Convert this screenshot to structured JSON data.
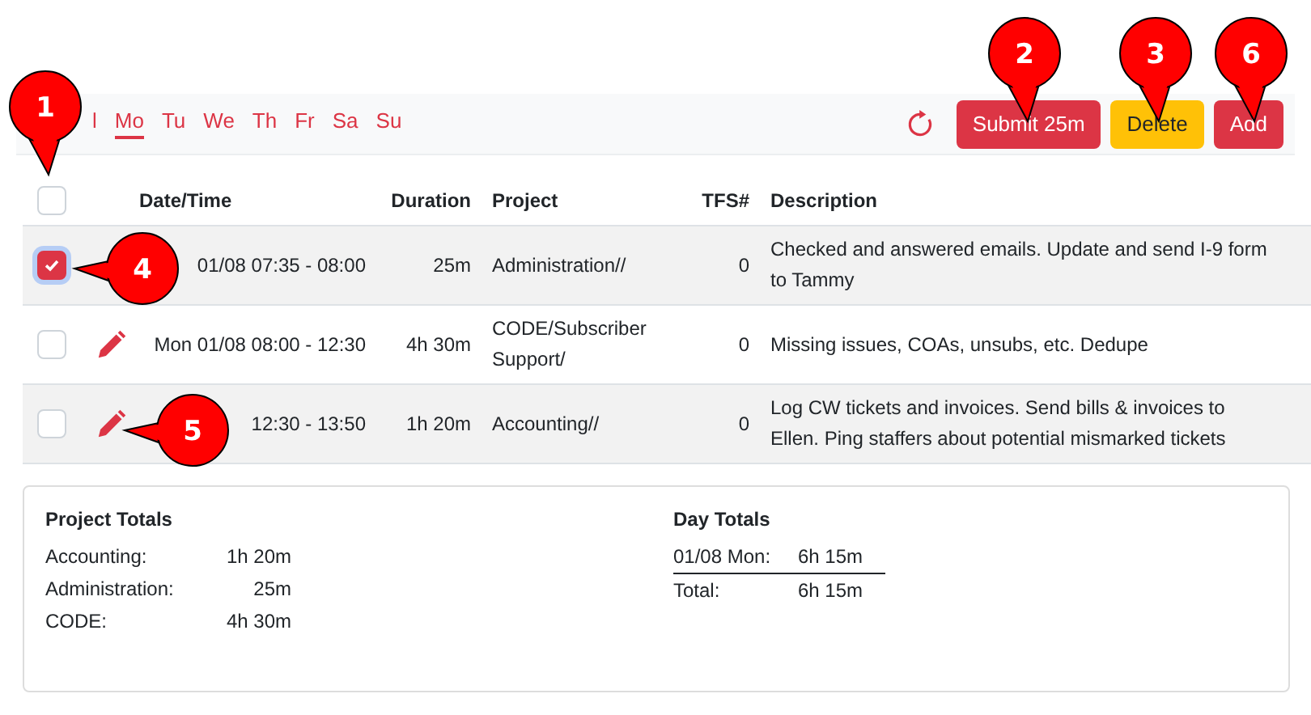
{
  "day_filters": [
    {
      "label": "l",
      "selected": false
    },
    {
      "label": "Mo",
      "selected": true
    },
    {
      "label": "Tu",
      "selected": false
    },
    {
      "label": "We",
      "selected": false
    },
    {
      "label": "Th",
      "selected": false
    },
    {
      "label": "Fr",
      "selected": false
    },
    {
      "label": "Sa",
      "selected": false
    },
    {
      "label": "Su",
      "selected": false
    }
  ],
  "toolbar_buttons": [
    {
      "label": "Submit 25m",
      "kind": "danger"
    },
    {
      "label": "Delete",
      "kind": "warning"
    },
    {
      "label": "Add",
      "kind": "danger"
    }
  ],
  "table": {
    "select_all_checked": false,
    "columns": [
      "Date/Time",
      "Duration",
      "Project",
      "TFS#",
      "Description"
    ],
    "rows": [
      {
        "checked": true,
        "edit_icon": false,
        "datetime": "01/08 07:35 - 08:00",
        "duration": "25m",
        "project": "Administration//",
        "tfs": "0",
        "description": "Checked and answered emails. Update and send I-9 form to Tammy"
      },
      {
        "checked": false,
        "edit_icon": true,
        "datetime": "Mon 01/08 08:00 - 12:30",
        "duration": "4h 30m",
        "project": "CODE/Subscriber Support/",
        "tfs": "0",
        "description": "Missing issues, COAs, unsubs, etc. Dedupe"
      },
      {
        "checked": false,
        "edit_icon": true,
        "datetime": "12:30 - 13:50",
        "duration": "1h 20m",
        "project": "Accounting//",
        "tfs": "0",
        "description": "Log CW tickets and invoices. Send bills & invoices to Ellen. Ping staffers about potential mismarked tickets"
      }
    ]
  },
  "project_totals": {
    "title": "Project Totals",
    "items": [
      {
        "label": "Accounting:",
        "value": "1h 20m"
      },
      {
        "label": "Administration:",
        "value": "25m"
      },
      {
        "label": "CODE:",
        "value": "4h 30m"
      }
    ]
  },
  "day_totals": {
    "title": "Day Totals",
    "items": [
      {
        "label": "01/08 Mon:",
        "value": "6h 15m"
      }
    ],
    "total": {
      "label": "Total:",
      "value": "6h 15m"
    }
  },
  "callouts": [
    {
      "number": "1"
    },
    {
      "number": "2"
    },
    {
      "number": "3"
    },
    {
      "number": "6"
    },
    {
      "number": "4"
    },
    {
      "number": "5"
    }
  ]
}
